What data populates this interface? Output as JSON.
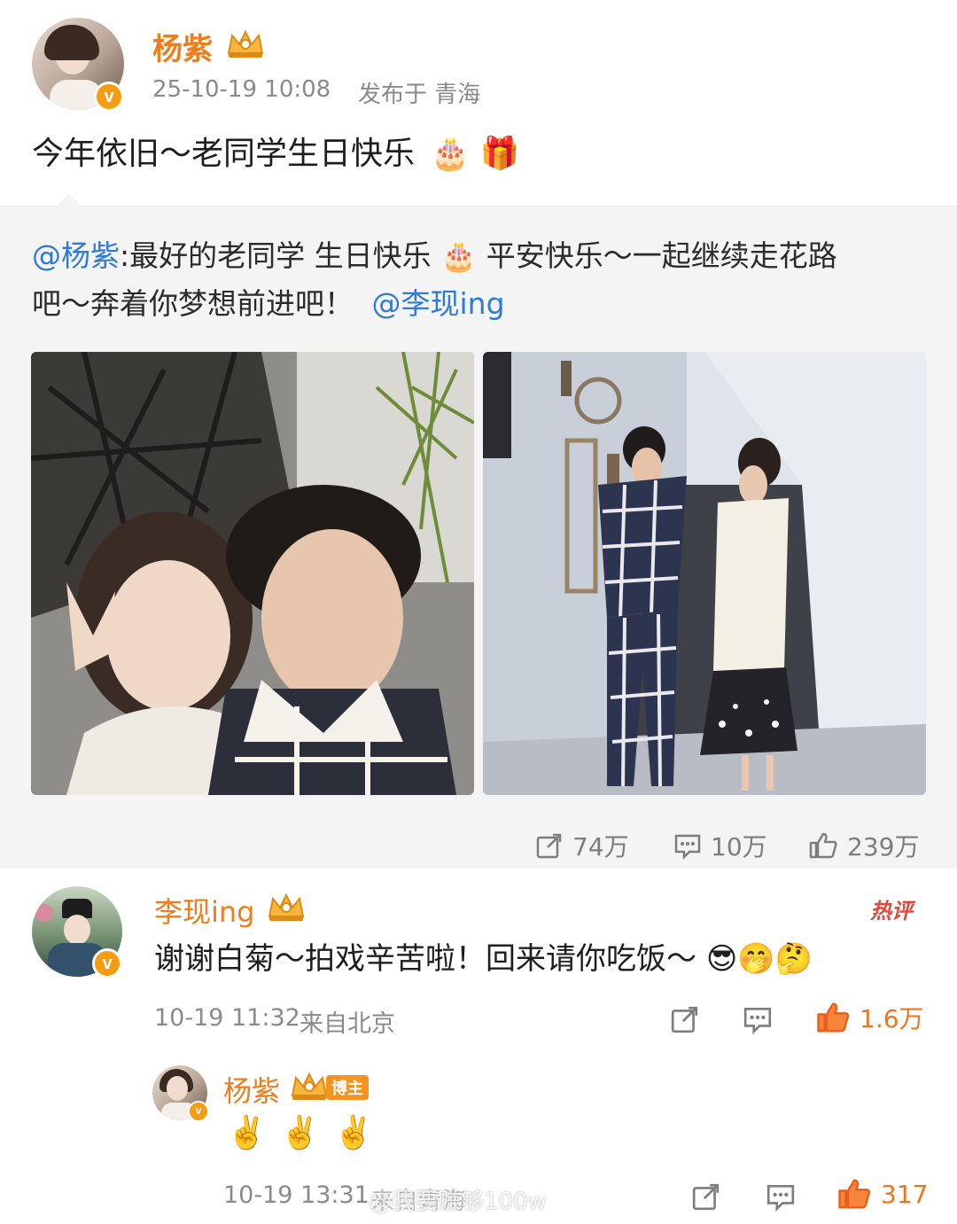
{
  "post": {
    "author": "杨紫",
    "timestamp": "25-10-19 10:08",
    "location_label": "发布于 青海",
    "text": "今年依旧～老同学生日快乐",
    "text_emojis": "🎂 🎁",
    "verified_badge": "v",
    "crown_icon": "crown-icon"
  },
  "repost": {
    "mention_author": "@杨紫",
    "text_line1": ":最好的老同学 生日快乐",
    "text_line1_emoji": "🎂",
    "text_line1_cont": "平安快乐～一起继续走花路",
    "text_line2": "吧～奔着你梦想前进吧！",
    "mention_target": "@李现ing",
    "photos": [
      "selfie-photo",
      "corridor-photo"
    ]
  },
  "stats": {
    "repost_count": "74万",
    "comment_count": "10万",
    "like_count": "239万"
  },
  "comments": [
    {
      "author": "李现ing",
      "hot_label": "热评",
      "text": "谢谢白菊～拍戏辛苦啦！回来请你吃饭～",
      "emojis": "😎🤭🤔",
      "time": "10-19 11:32",
      "source": "来自北京",
      "like_count": "1.6万"
    },
    {
      "author": "杨紫",
      "owner_badge": "博主",
      "text": "✌️ ✌️ ✌️",
      "time": "10-19 13:31",
      "source": "来自青海",
      "like_count": "317"
    }
  ],
  "watermark": "@我要赚够100w",
  "colors": {
    "name_orange": "#f07d1a",
    "link_blue": "#2f7bd6",
    "repost_bg": "#f4f4f4",
    "like_orange": "#f2741a",
    "hot_red": "#e8453c"
  }
}
